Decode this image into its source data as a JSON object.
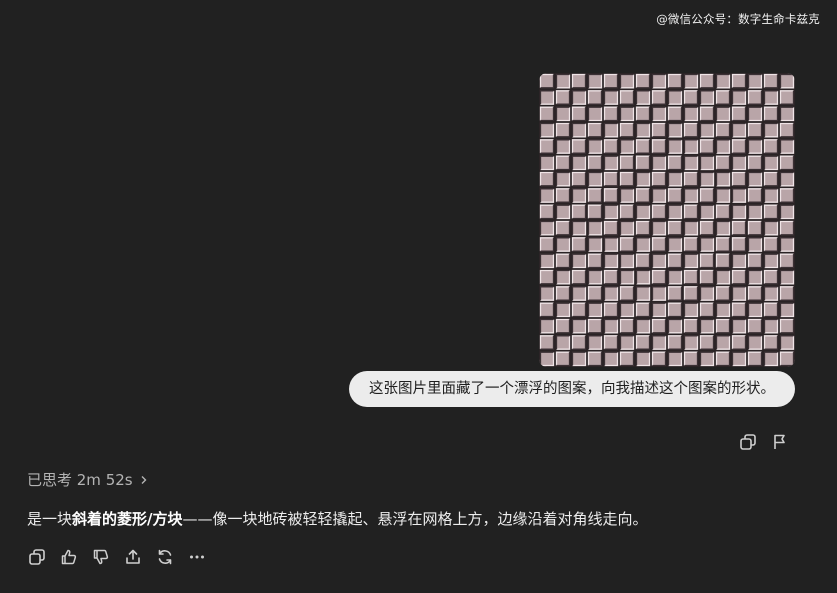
{
  "watermark": "@微信公众号：数字生命卡兹克",
  "user_message": {
    "text": "这张图片里面藏了一个漂浮的图案，向我描述这个图案的形状。",
    "image_icon": "optical-illusion-grid-image"
  },
  "user_actions": [
    {
      "icon": "copy-icon"
    },
    {
      "icon": "flag-icon"
    }
  ],
  "assistant": {
    "thinking_label": "已思考 2m 52s",
    "answer": {
      "prefix": "是一块",
      "bold": "斜着的菱形/方块",
      "suffix": "——像一块地砖被轻轻撬起、悬浮在网格上方，边缘沿着对角线走向。"
    },
    "actions": [
      {
        "icon": "copy-icon"
      },
      {
        "icon": "thumbs-up-icon"
      },
      {
        "icon": "thumbs-down-icon"
      },
      {
        "icon": "share-icon"
      },
      {
        "icon": "regenerate-icon"
      },
      {
        "icon": "more-icon"
      }
    ]
  },
  "colors": {
    "background": "#212121",
    "bubble": "#ececec",
    "tile": "#b9a5a8",
    "text": "#ececec",
    "muted": "#b4b4b4"
  }
}
